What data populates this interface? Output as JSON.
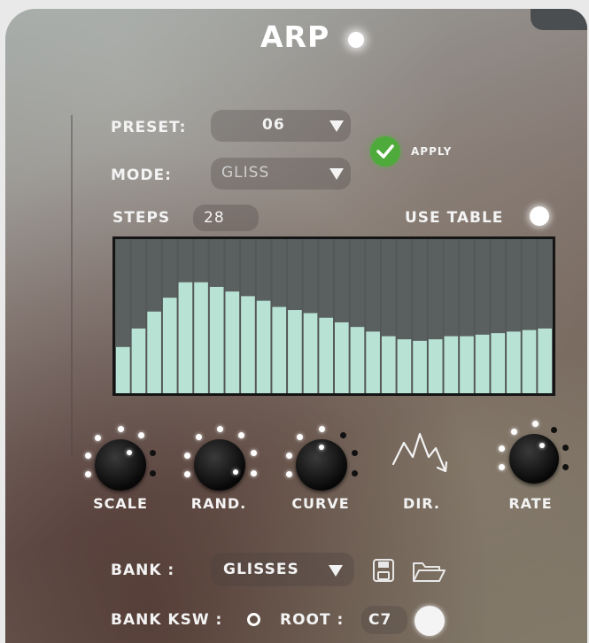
{
  "title": "ARP",
  "preset": {
    "label": "PRESET:",
    "value": "06"
  },
  "mode": {
    "label": "MODE:",
    "value": "GLISS"
  },
  "apply_label": "APPLY",
  "steps": {
    "label": "STEPS",
    "value": "28"
  },
  "use_table_label": "USE TABLE",
  "step_levels": [
    0.3,
    0.42,
    0.53,
    0.62,
    0.72,
    0.72,
    0.69,
    0.66,
    0.63,
    0.6,
    0.56,
    0.54,
    0.52,
    0.49,
    0.46,
    0.43,
    0.4,
    0.37,
    0.35,
    0.34,
    0.35,
    0.37,
    0.37,
    0.38,
    0.39,
    0.4,
    0.41,
    0.42
  ],
  "knobs": [
    {
      "label": "SCALE"
    },
    {
      "label": "RAND."
    },
    {
      "label": "CURVE"
    },
    {
      "label": "DIR."
    },
    {
      "label": "RATE"
    }
  ],
  "bank": {
    "label": "BANK :",
    "value": "GLISSES"
  },
  "bank_ksw_label": "BANK KSW :",
  "root": {
    "label": "ROOT :",
    "value": "C7"
  },
  "colors": {
    "bar": "#b8e3d4",
    "check": "#4eaa3a",
    "table_bg": "#545858"
  }
}
